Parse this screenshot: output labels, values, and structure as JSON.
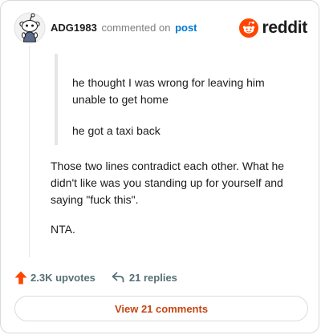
{
  "header": {
    "username": "ADG1983",
    "action_text": "commented on",
    "post_link": "post",
    "brand_name": "reddit",
    "brand_color": "#ff4500",
    "avatar_icon": "snoo-avatar-icon"
  },
  "quote": {
    "line1": "he thought I was wrong for leaving him unable to get home",
    "line2": "he got a taxi back"
  },
  "comment": {
    "paragraph1": "Those two lines contradict each other. What he didn't like was you standing up for yourself and saying \"fuck this\".",
    "paragraph2": "NTA."
  },
  "stats": {
    "upvotes": "2.3K upvotes",
    "upvote_color": "#ff4500",
    "replies": "21 replies"
  },
  "actions": {
    "view_comments_label": "View 21 comments",
    "accent_color": "#c64512"
  }
}
